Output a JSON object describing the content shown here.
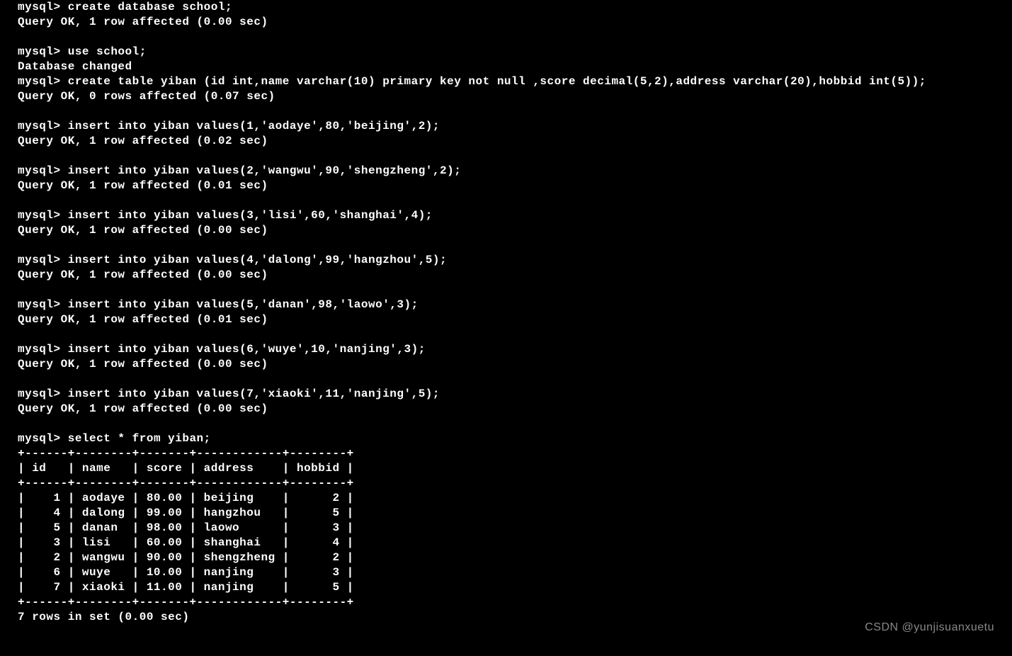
{
  "prompt": "mysql>",
  "commands": [
    {
      "cmd": "create database school;",
      "result": "Query OK, 1 row affected (0.00 sec)"
    },
    {
      "cmd": "use school;",
      "result": "Database changed"
    },
    {
      "cmd": "create table yiban (id int,name varchar(10) primary key not null ,score decimal(5,2),address varchar(20),hobbid int(5));",
      "result": "Query OK, 0 rows affected (0.07 sec)"
    },
    {
      "cmd": "insert into yiban values(1,'aodaye',80,'beijing',2);",
      "result": "Query OK, 1 row affected (0.02 sec)"
    },
    {
      "cmd": "insert into yiban values(2,'wangwu',90,'shengzheng',2);",
      "result": "Query OK, 1 row affected (0.01 sec)"
    },
    {
      "cmd": "insert into yiban values(3,'lisi',60,'shanghai',4);",
      "result": "Query OK, 1 row affected (0.00 sec)"
    },
    {
      "cmd": "insert into yiban values(4,'dalong',99,'hangzhou',5);",
      "result": "Query OK, 1 row affected (0.00 sec)"
    },
    {
      "cmd": "insert into yiban values(5,'danan',98,'laowo',3);",
      "result": "Query OK, 1 row affected (0.01 sec)"
    },
    {
      "cmd": "insert into yiban values(6,'wuye',10,'nanjing',3);",
      "result": "Query OK, 1 row affected (0.00 sec)"
    },
    {
      "cmd": "insert into yiban values(7,'xiaoki',11,'nanjing',5);",
      "result": "Query OK, 1 row affected (0.00 sec)"
    },
    {
      "cmd": "select * from yiban;",
      "result": ""
    }
  ],
  "table": {
    "separator": "+------+--------+-------+------------+--------+",
    "header": "| id   | name   | score | address    | hobbid |",
    "columns": [
      "id",
      "name",
      "score",
      "address",
      "hobbid"
    ],
    "rows": [
      {
        "id": 1,
        "name": "aodaye",
        "score": "80.00",
        "address": "beijing",
        "hobbid": 2,
        "line": "|    1 | aodaye | 80.00 | beijing    |      2 |"
      },
      {
        "id": 4,
        "name": "dalong",
        "score": "99.00",
        "address": "hangzhou",
        "hobbid": 5,
        "line": "|    4 | dalong | 99.00 | hangzhou   |      5 |"
      },
      {
        "id": 5,
        "name": "danan",
        "score": "98.00",
        "address": "laowo",
        "hobbid": 3,
        "line": "|    5 | danan  | 98.00 | laowo      |      3 |"
      },
      {
        "id": 3,
        "name": "lisi",
        "score": "60.00",
        "address": "shanghai",
        "hobbid": 4,
        "line": "|    3 | lisi   | 60.00 | shanghai   |      4 |"
      },
      {
        "id": 2,
        "name": "wangwu",
        "score": "90.00",
        "address": "shengzheng",
        "hobbid": 2,
        "line": "|    2 | wangwu | 90.00 | shengzheng |      2 |"
      },
      {
        "id": 6,
        "name": "wuye",
        "score": "10.00",
        "address": "nanjing",
        "hobbid": 3,
        "line": "|    6 | wuye   | 10.00 | nanjing    |      3 |"
      },
      {
        "id": 7,
        "name": "xiaoki",
        "score": "11.00",
        "address": "nanjing",
        "hobbid": 5,
        "line": "|    7 | xiaoki | 11.00 | nanjing    |      5 |"
      }
    ],
    "footer": "7 rows in set (0.00 sec)"
  },
  "watermark": "CSDN @yunjisuanxuetu"
}
